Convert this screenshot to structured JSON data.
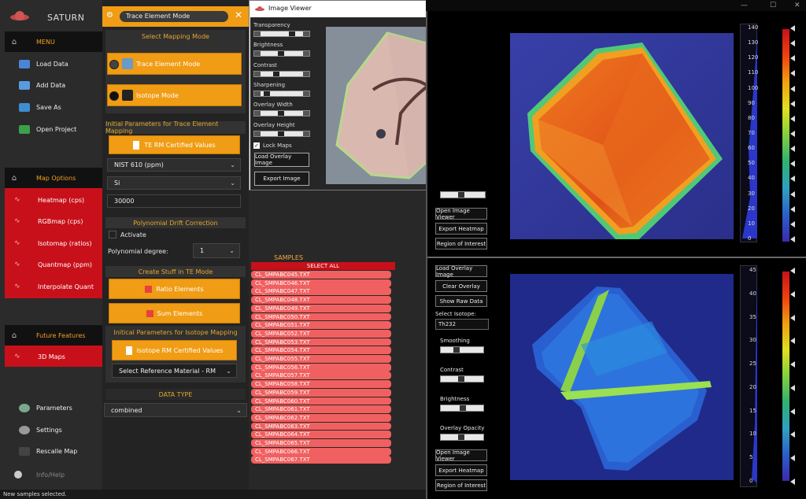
{
  "app": {
    "title": "SATURN"
  },
  "sidebar": {
    "menu_label": "MENU",
    "menu_items": [
      {
        "label": "Load Data"
      },
      {
        "label": "Add Data"
      },
      {
        "label": "Save As"
      },
      {
        "label": "Open Project"
      }
    ],
    "map_options_label": "Map Options",
    "map_items": [
      {
        "label": "Heatmap (cps)"
      },
      {
        "label": "RGBmap (cps)"
      },
      {
        "label": "Isotomap (ratios)"
      },
      {
        "label": "Quantmap (ppm)"
      },
      {
        "label": "Interpolate Quant"
      }
    ],
    "future_label": "Future Features",
    "future_items": [
      {
        "label": "3D Maps"
      }
    ],
    "bottom_items": [
      {
        "label": "Parameters"
      },
      {
        "label": "Settings"
      },
      {
        "label": "Rescalle Map"
      },
      {
        "label": "Info/Help"
      }
    ]
  },
  "mode": {
    "selected": "Trace Element Mode",
    "section_title": "Select Mapping Mode",
    "trace_label": "Trace Element Mode",
    "isotope_label": "Isotope Mode"
  },
  "trace_params": {
    "section_title": "Initial Parameters for Trace Element Mapping",
    "certified_button": "TE RM Certified Values",
    "reference": "NIST 610 (ppm)",
    "element": "Si",
    "value": "30000"
  },
  "drift": {
    "section_title": "Polynomial Drift Correction",
    "activate_label": "Activate",
    "degree_label": "Polynomial degree:",
    "degree": "1"
  },
  "te_mode": {
    "section_title": "Create Stuff in TE Mode",
    "ratio_button": "Ratio Elements",
    "sum_button": "Sum Elements"
  },
  "isotope_params": {
    "section_title": "Initical Parameters for Isotope Mapping",
    "certified_button": "Isotope RM Certified Values",
    "reference": "Select Reference Material - RM"
  },
  "data_type": {
    "section_title": "DATA TYPE",
    "value": "combined"
  },
  "samples": {
    "title": "SAMPLES",
    "select_all": "SELECT ALL",
    "items": [
      "CL_SMPABC045.TXT",
      "CL_SMPABC046.TXT",
      "CL_SMPABC047.TXT",
      "CL_SMPABC048.TXT",
      "CL_SMPABC049.TXT",
      "CL_SMPABC050.TXT",
      "CL_SMPABC051.TXT",
      "CL_SMPABC052.TXT",
      "CL_SMPABC053.TXT",
      "CL_SMPABC054.TXT",
      "CL_SMPABC055.TXT",
      "CL_SMPABC056.TXT",
      "CL_SMPABC057.TXT",
      "CL_SMPABC058.TXT",
      "CL_SMPABC059.TXT",
      "CL_SMPABC060.TXT",
      "CL_SMPABC061.TXT",
      "CL_SMPABC062.TXT",
      "CL_SMPABC063.TXT",
      "CL_SMPABC064.TXT",
      "CL_SMPABC065.TXT",
      "CL_SMPABC066.TXT",
      "CL_SMPABC067.TXT"
    ]
  },
  "image_viewer": {
    "title": "Image Viewer",
    "sliders": [
      "Transparency",
      "Brightness",
      "Contrast",
      "Sharpening",
      "Overlay Width",
      "Overlay Height"
    ],
    "lock_label": "Lock Maps",
    "load_button": "Load Overlay Image",
    "export_button": "Export Image"
  },
  "top_map": {
    "buttons": [
      "Open Image Viewer",
      "Export Heatmap",
      "Region of Interest"
    ],
    "colorbar_ticks": [
      "140",
      "130",
      "120",
      "110",
      "100",
      "90",
      "80",
      "70",
      "60",
      "50",
      "40",
      "30",
      "20",
      "10",
      "0"
    ]
  },
  "bottom_map": {
    "buttons_top": [
      "Load Overlay Image",
      "Clear Overlay",
      "Show Raw Data"
    ],
    "isotope_label": "Select Isotope:",
    "isotope_value": "Th232",
    "slider_labels": [
      "Smoothing",
      "Contrast",
      "Brightness",
      "Overlay Opacity"
    ],
    "buttons_bottom": [
      "Open Image Viewer",
      "Export Heatmap",
      "Region of Interest"
    ],
    "colorbar_ticks": [
      "45",
      "40",
      "35",
      "30",
      "25",
      "20",
      "15",
      "10",
      "5",
      "0"
    ]
  },
  "status": {
    "text": "New samples selected."
  },
  "colors": {
    "accent": "#f09c14",
    "red": "#c8101a",
    "sample": "#f16060"
  }
}
